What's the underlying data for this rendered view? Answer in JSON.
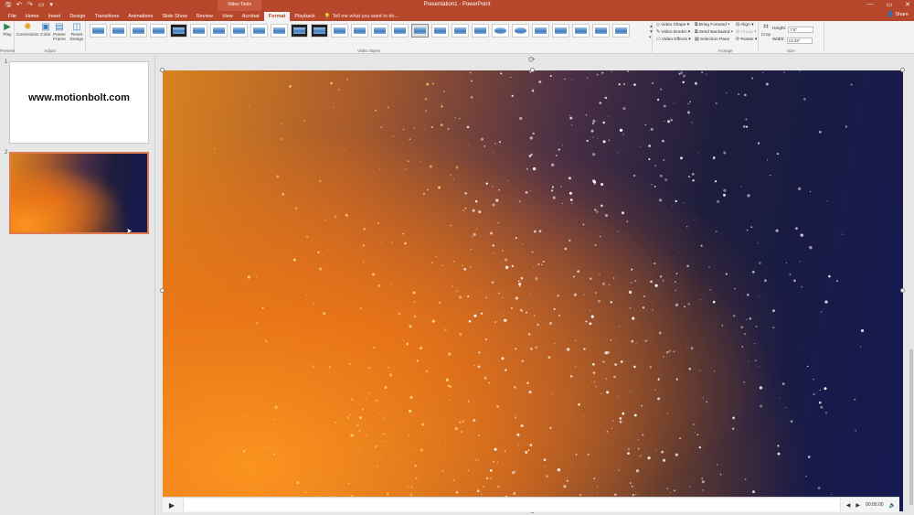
{
  "window": {
    "title": "Presentation1 - PowerPoint",
    "context_group": "Video Tools",
    "controls": [
      "—",
      "▭",
      "✕"
    ]
  },
  "tabs": [
    {
      "label": "File"
    },
    {
      "label": "Home"
    },
    {
      "label": "Insert"
    },
    {
      "label": "Design"
    },
    {
      "label": "Transitions"
    },
    {
      "label": "Animations"
    },
    {
      "label": "Slide Show"
    },
    {
      "label": "Review"
    },
    {
      "label": "View"
    },
    {
      "label": "Acrobat"
    },
    {
      "label": "Format"
    },
    {
      "label": "Playback"
    }
  ],
  "tell_me": "Tell me what you want to do...",
  "share": "Share",
  "ribbon": {
    "preview": {
      "play": "Play",
      "group": "Preview"
    },
    "adjust": {
      "corrections": "Corrections",
      "color": "Color",
      "poster_frame": "Poster Frame",
      "reset_design": "Reset Design",
      "group": "Adjust"
    },
    "video_styles": {
      "group": "Video Styles"
    },
    "shape_opts": {
      "shape": "Video Shape",
      "border": "Video Border",
      "effects": "Video Effects"
    },
    "arrange": {
      "bring_forward": "Bring Forward",
      "send_backward": "Send Backward",
      "selection_pane": "Selection Pane",
      "align": "Align",
      "group_btn": "Group",
      "rotate": "Rotate",
      "group": "Arrange"
    },
    "size": {
      "crop": "Crop",
      "height_label": "Height:",
      "height_value": "7.5\"",
      "width_label": "Width:",
      "width_value": "13.33\"",
      "group": "Size"
    }
  },
  "slides": [
    {
      "number": "1",
      "text": "www.motionbolt.com"
    },
    {
      "number": "2"
    }
  ],
  "player": {
    "time": "00:00.00"
  }
}
